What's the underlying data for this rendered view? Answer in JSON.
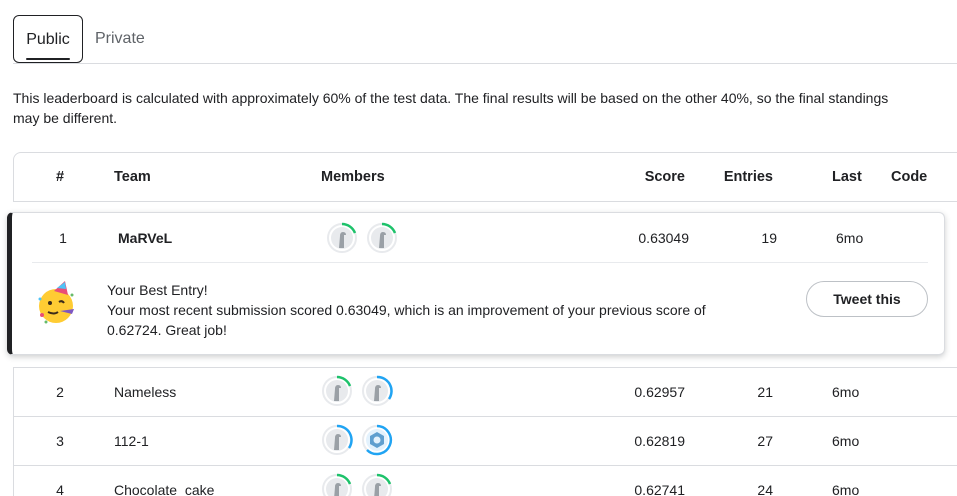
{
  "tabs": [
    {
      "label": "Public",
      "active": true
    },
    {
      "label": "Private",
      "active": false
    }
  ],
  "note": "This leaderboard is calculated with approximately 60% of the test data. The final results will be based on the other 40%, so the final standings may be different.",
  "columns": {
    "rank": "#",
    "team": "Team",
    "members": "Members",
    "score": "Score",
    "entries": "Entries",
    "last": "Last",
    "code": "Code"
  },
  "best": {
    "rank": "1",
    "team": "MaRVeL",
    "score": "0.63049",
    "entries": "19",
    "last": "6mo",
    "emoji_icon": "partying-face-icon",
    "title": "Your Best Entry!",
    "message": "Your most recent submission scored 0.63049, which is an improvement of your previous score of 0.62724. Great job!",
    "tweet_label": "Tweet this"
  },
  "rows": [
    {
      "rank": "2",
      "team": "Nameless",
      "score": "0.62957",
      "entries": "21",
      "last": "6mo"
    },
    {
      "rank": "3",
      "team": "112-1",
      "score": "0.62819",
      "entries": "27",
      "last": "6mo"
    },
    {
      "rank": "4",
      "team": "Chocolate_cake",
      "score": "0.62741",
      "entries": "24",
      "last": "6mo"
    }
  ],
  "colors": {
    "ring_green": "#20beff",
    "ring_green_alt": "#1ec26b",
    "ring_blue": "#20a4f3",
    "text": "#202124",
    "muted": "#5f6368",
    "border": "#dadce0"
  }
}
